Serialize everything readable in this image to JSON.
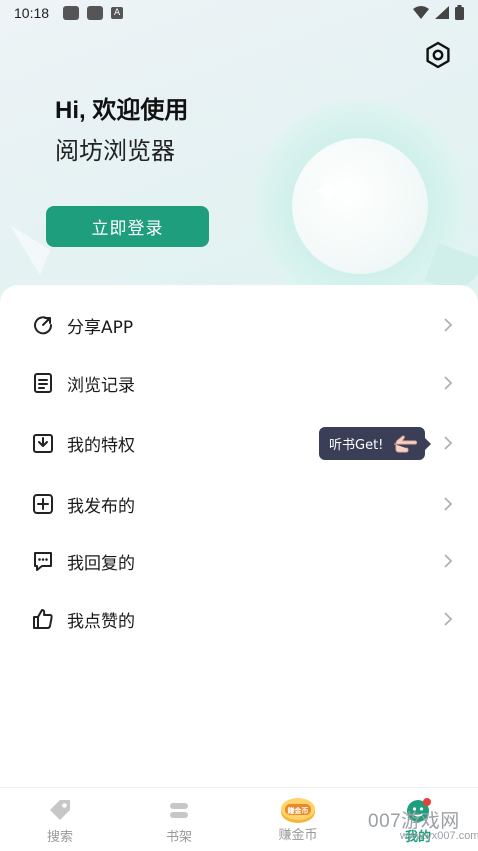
{
  "status_bar": {
    "time": "10:18",
    "a_badge": "A"
  },
  "hero": {
    "greeting": "Hi, 欢迎使用",
    "app_name": "阅坊浏览器",
    "login_label": "立即登录"
  },
  "menu": {
    "items": [
      {
        "label": "分享APP",
        "icon": "share-icon"
      },
      {
        "label": "浏览记录",
        "icon": "history-icon"
      },
      {
        "label": "我的特权",
        "icon": "privilege-icon"
      },
      {
        "label": "我发布的",
        "icon": "add-post-icon"
      },
      {
        "label": "我回复的",
        "icon": "reply-icon"
      },
      {
        "label": "我点赞的",
        "icon": "thumbs-up-icon"
      }
    ],
    "tooltip": "听书Get!"
  },
  "tabbar": {
    "tabs": [
      {
        "label": "搜索",
        "icon": "search-tag-icon"
      },
      {
        "label": "书架",
        "icon": "bookshelf-icon"
      },
      {
        "label": "赚金币",
        "icon": "coin-icon",
        "badge": "赚金币"
      },
      {
        "label": "我的",
        "icon": "profile-icon",
        "active": true
      }
    ]
  },
  "watermark": {
    "text": "007游戏网",
    "url": "www.yx007.com"
  },
  "colors": {
    "accent": "#1f9e7d",
    "tooltip_bg": "#3a3f57",
    "hero_bg": "#e6f2f3"
  }
}
